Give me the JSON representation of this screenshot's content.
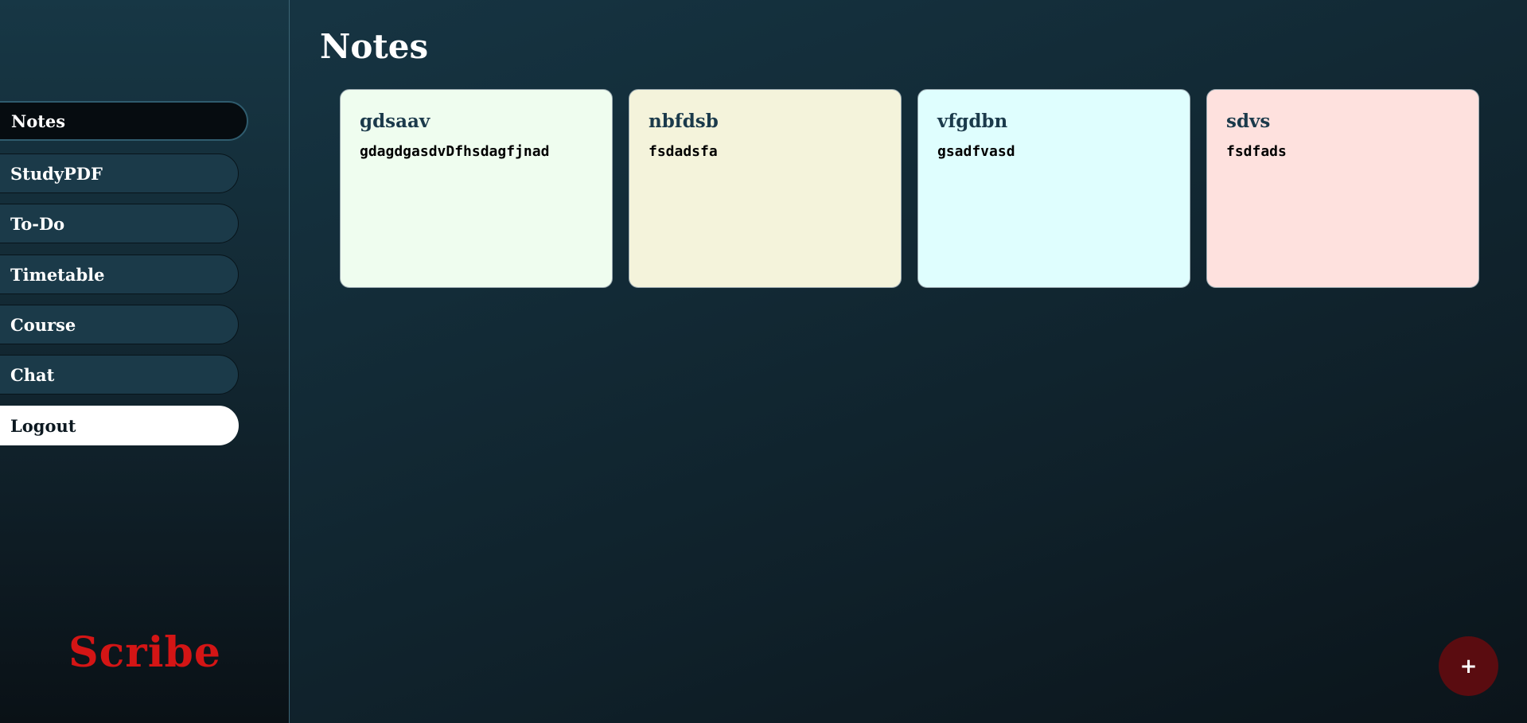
{
  "sidebar": {
    "items": [
      {
        "label": "Notes",
        "active": true
      },
      {
        "label": "StudyPDF"
      },
      {
        "label": "To-Do"
      },
      {
        "label": "Timetable"
      },
      {
        "label": "Course"
      },
      {
        "label": "Chat"
      },
      {
        "label": "Logout"
      }
    ],
    "brand": "Scribe"
  },
  "main": {
    "title": "Notes",
    "notes": [
      {
        "title": "gdsaav",
        "body": "gdagdgasdvDfhsdagfjnad",
        "color": "#effdef"
      },
      {
        "title": "nbfdsb",
        "body": "fsdadsfa",
        "color": "#f4f3db"
      },
      {
        "title": "vfgdbn",
        "body": "gsadfvasd",
        "color": "#dffefe"
      },
      {
        "title": "sdvs",
        "body": "fsdfads",
        "color": "#fee1de"
      }
    ],
    "add_button": "+"
  },
  "colors": {
    "accent": "#d41515",
    "fab": "#5a0c10",
    "sidebar_item": "#1b3a49"
  }
}
